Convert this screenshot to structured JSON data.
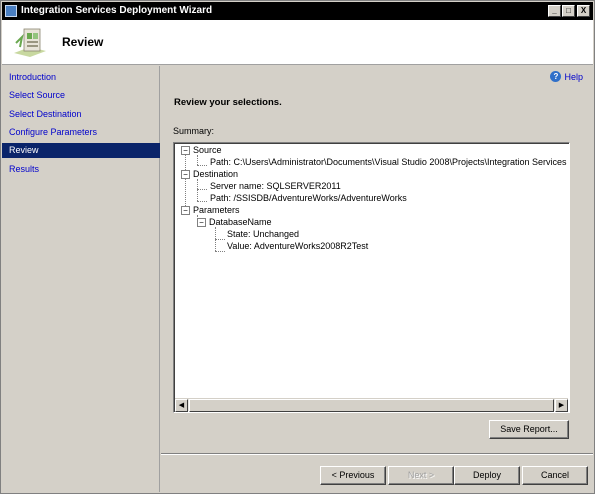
{
  "window": {
    "title": "Integration Services Deployment Wizard",
    "controls": {
      "minimize": "_",
      "maximize": "□",
      "close": "X"
    }
  },
  "header": {
    "title": "Review",
    "icon": "wizard-page-graphic"
  },
  "sidebar": {
    "items": [
      {
        "label": "Introduction",
        "active": false
      },
      {
        "label": "Select Source",
        "active": false
      },
      {
        "label": "Select Destination",
        "active": false
      },
      {
        "label": "Configure Parameters",
        "active": false
      },
      {
        "label": "Review",
        "active": true
      },
      {
        "label": "Results",
        "active": false
      }
    ]
  },
  "content": {
    "help_label": "Help",
    "heading": "Review your selections.",
    "summary_label": "Summary:",
    "tree": {
      "source": {
        "label": "Source",
        "path": "Path: C:\\Users\\Administrator\\Documents\\Visual Studio 2008\\Projects\\Integration Services"
      },
      "destination": {
        "label": "Destination",
        "server": "Server name: SQLSERVER2011",
        "path": "Path: /SSISDB/AdventureWorks/AdventureWorks"
      },
      "parameters": {
        "label": "Parameters",
        "database_name": {
          "label": "DatabaseName",
          "state": "State: Unchanged",
          "value": "Value: AdventureWorks2008R2Test"
        }
      }
    },
    "save_report": "Save Report..."
  },
  "footer": {
    "previous": "< Previous",
    "next": "Next >",
    "deploy": "Deploy",
    "cancel": "Cancel"
  },
  "colors": {
    "titlebar": "#000000",
    "selection": "#0a246a",
    "link": "#0000cc",
    "face": "#d4d0c8"
  }
}
